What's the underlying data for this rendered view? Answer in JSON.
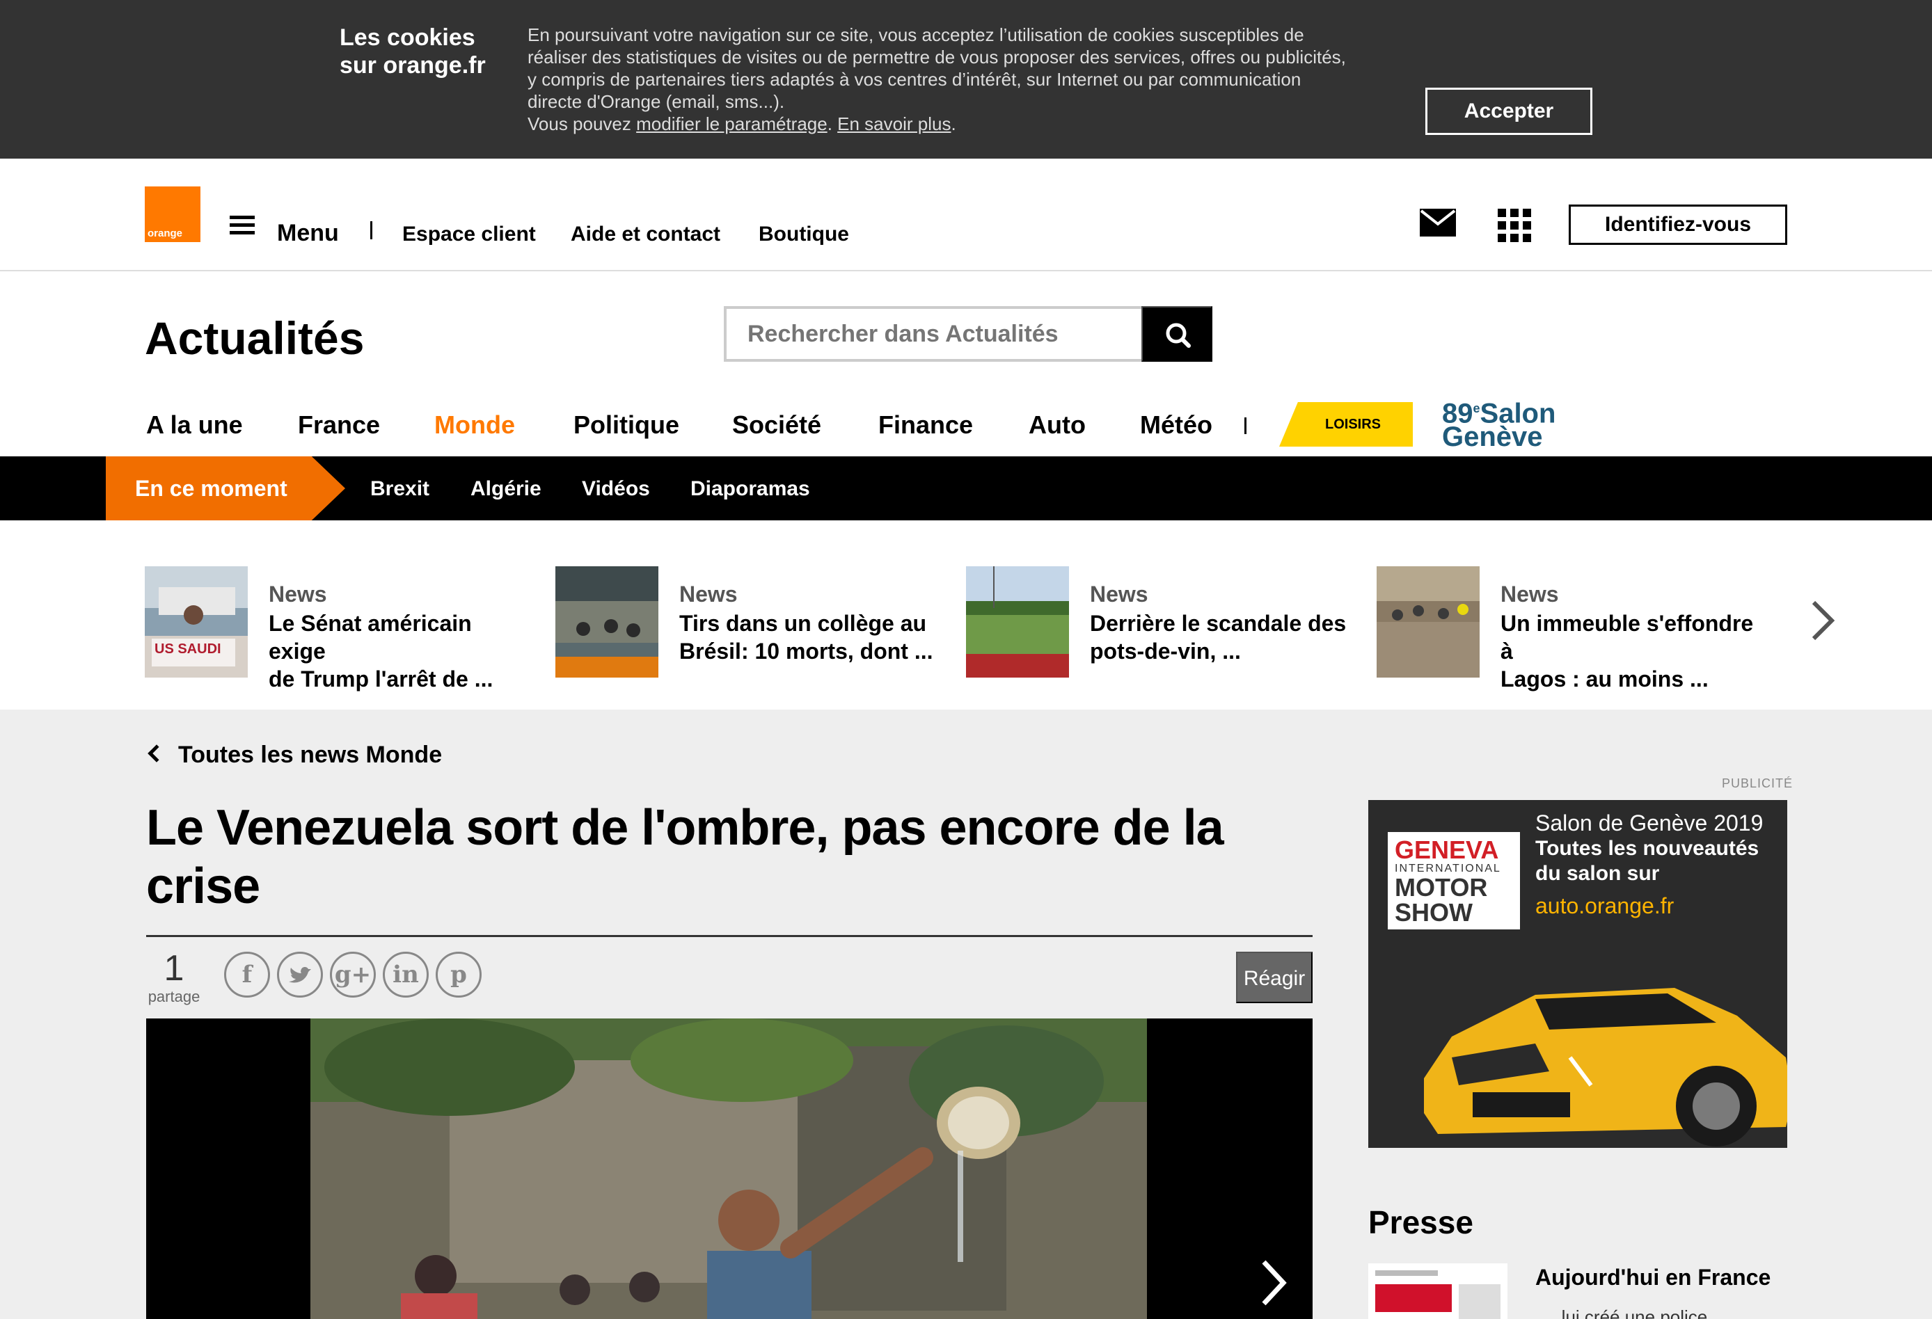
{
  "cookie": {
    "title_line1": "Les cookies",
    "title_line2": "sur orange.fr",
    "text_line1": "En poursuivant votre navigation sur ce site, vous acceptez l’utilisation de cookies susceptibles de",
    "text_line2": "réaliser des statistiques de visites ou de permettre de vous proposer des services, offres ou publicités,",
    "text_line3": "y compris de partenaires tiers adaptés à vos centres d’intérêt, sur Internet ou par communication",
    "text_line4": "directe d'Orange (email, sms...).",
    "text_prefix": "Vous pouvez ",
    "link_settings": "modifier le paramétrage",
    "sep": ". ",
    "link_more": "En savoir plus",
    "end": ".",
    "accept_label": "Accepter"
  },
  "topbar": {
    "logo_text": "orange",
    "menu_label": "Menu",
    "links": [
      "Espace client",
      "Aide et contact",
      "Boutique"
    ],
    "identify_label": "Identifiez-vous",
    "icons": [
      "mail-icon",
      "apps-grid-icon",
      "hamburger-icon"
    ]
  },
  "section": {
    "title": "Actualités",
    "search_placeholder": "Rechercher dans Actualités"
  },
  "nav": {
    "items": [
      "A la une",
      "France",
      "Monde",
      "Politique",
      "Société",
      "Finance",
      "Auto",
      "Météo"
    ],
    "active": "Monde",
    "loisirs_label": "LOISIRS",
    "salon_num": "89",
    "salon_sup": "e",
    "salon_word1": "Salon",
    "salon_word2": "Genève"
  },
  "moment": {
    "label": "En ce moment",
    "items": [
      "Brexit",
      "Algérie",
      "Vidéos",
      "Diaporamas"
    ]
  },
  "news": [
    {
      "category": "News",
      "title_l1": "Le Sénat américain exige",
      "title_l2": "de Trump l'arrêt de ..."
    },
    {
      "category": "News",
      "title_l1": "Tirs dans un collège au",
      "title_l2": "Brésil: 10 morts, dont ..."
    },
    {
      "category": "News",
      "title_l1": "Derrière le scandale des",
      "title_l2": "pots-de-vin, ..."
    },
    {
      "category": "News",
      "title_l1": "Un immeuble s'effondre à",
      "title_l2": "Lagos : au moins ..."
    }
  ],
  "article": {
    "back_label": "Toutes les news Monde",
    "title_l1": "Le Venezuela sort de l'ombre, pas encore de la",
    "title_l2": "crise",
    "share_count": "1",
    "share_label": "partage",
    "react_label": "Réagir",
    "social": [
      "facebook-icon",
      "twitter-icon",
      "google-plus-icon",
      "linkedin-icon",
      "pinterest-icon"
    ]
  },
  "sidebar": {
    "pub_label": "PUBLICITÉ",
    "ad_brand_1": "GENEVA",
    "ad_brand_2": "INTERNATIONAL",
    "ad_brand_3": "MOTOR",
    "ad_brand_4": "SHOW",
    "ad_line1": "Salon de Genève 2019",
    "ad_line2": "Toutes les nouveautés",
    "ad_line3": "du salon sur",
    "ad_line4": "auto.orange.fr",
    "presse_title": "Presse",
    "presse_name": "Aujourd'hui en France",
    "presse_sub": "...lui créé une police"
  },
  "colors": {
    "orange": "#ff7900",
    "moment_orange": "#f16e00",
    "loisirs_yellow": "#ffd200",
    "cookie_bg": "#333333",
    "grey_bg": "#eeeeee"
  }
}
